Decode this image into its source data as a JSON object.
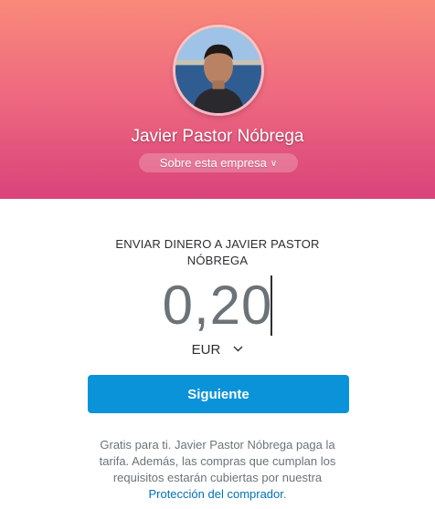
{
  "profile": {
    "name": "Javier Pastor Nóbrega",
    "about_label": "Sobre esta empresa",
    "about_icon": "chevron-down-icon"
  },
  "payment": {
    "title": "ENVIAR DINERO A JAVIER PASTOR NÓBREGA",
    "amount": "0,20",
    "currency": "EUR",
    "currency_icon": "chevron-down-icon",
    "next_label": "Siguiente"
  },
  "footer": {
    "text": "Gratis para ti. Javier Pastor Nóbrega paga la tarifa. Además, las compras que cumplan los requisitos estarán cubiertas por nuestra",
    "link_text": "Protección del comprador",
    "period": "."
  },
  "colors": {
    "header_gradient_top": "#f98a7a",
    "header_gradient_bottom": "#d9437a",
    "primary_button": "#0a93d8",
    "link": "#0070ba"
  }
}
